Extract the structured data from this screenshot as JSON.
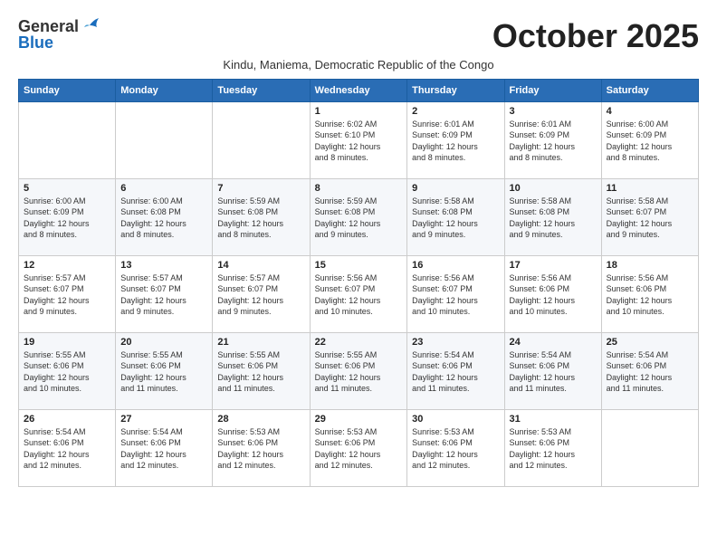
{
  "header": {
    "logo_general": "General",
    "logo_blue": "Blue",
    "month_title": "October 2025",
    "subtitle": "Kindu, Maniema, Democratic Republic of the Congo"
  },
  "weekdays": [
    "Sunday",
    "Monday",
    "Tuesday",
    "Wednesday",
    "Thursday",
    "Friday",
    "Saturday"
  ],
  "weeks": [
    [
      {
        "day": "",
        "info": ""
      },
      {
        "day": "",
        "info": ""
      },
      {
        "day": "",
        "info": ""
      },
      {
        "day": "1",
        "info": "Sunrise: 6:02 AM\nSunset: 6:10 PM\nDaylight: 12 hours\nand 8 minutes."
      },
      {
        "day": "2",
        "info": "Sunrise: 6:01 AM\nSunset: 6:09 PM\nDaylight: 12 hours\nand 8 minutes."
      },
      {
        "day": "3",
        "info": "Sunrise: 6:01 AM\nSunset: 6:09 PM\nDaylight: 12 hours\nand 8 minutes."
      },
      {
        "day": "4",
        "info": "Sunrise: 6:00 AM\nSunset: 6:09 PM\nDaylight: 12 hours\nand 8 minutes."
      }
    ],
    [
      {
        "day": "5",
        "info": "Sunrise: 6:00 AM\nSunset: 6:09 PM\nDaylight: 12 hours\nand 8 minutes."
      },
      {
        "day": "6",
        "info": "Sunrise: 6:00 AM\nSunset: 6:08 PM\nDaylight: 12 hours\nand 8 minutes."
      },
      {
        "day": "7",
        "info": "Sunrise: 5:59 AM\nSunset: 6:08 PM\nDaylight: 12 hours\nand 8 minutes."
      },
      {
        "day": "8",
        "info": "Sunrise: 5:59 AM\nSunset: 6:08 PM\nDaylight: 12 hours\nand 9 minutes."
      },
      {
        "day": "9",
        "info": "Sunrise: 5:58 AM\nSunset: 6:08 PM\nDaylight: 12 hours\nand 9 minutes."
      },
      {
        "day": "10",
        "info": "Sunrise: 5:58 AM\nSunset: 6:08 PM\nDaylight: 12 hours\nand 9 minutes."
      },
      {
        "day": "11",
        "info": "Sunrise: 5:58 AM\nSunset: 6:07 PM\nDaylight: 12 hours\nand 9 minutes."
      }
    ],
    [
      {
        "day": "12",
        "info": "Sunrise: 5:57 AM\nSunset: 6:07 PM\nDaylight: 12 hours\nand 9 minutes."
      },
      {
        "day": "13",
        "info": "Sunrise: 5:57 AM\nSunset: 6:07 PM\nDaylight: 12 hours\nand 9 minutes."
      },
      {
        "day": "14",
        "info": "Sunrise: 5:57 AM\nSunset: 6:07 PM\nDaylight: 12 hours\nand 9 minutes."
      },
      {
        "day": "15",
        "info": "Sunrise: 5:56 AM\nSunset: 6:07 PM\nDaylight: 12 hours\nand 10 minutes."
      },
      {
        "day": "16",
        "info": "Sunrise: 5:56 AM\nSunset: 6:07 PM\nDaylight: 12 hours\nand 10 minutes."
      },
      {
        "day": "17",
        "info": "Sunrise: 5:56 AM\nSunset: 6:06 PM\nDaylight: 12 hours\nand 10 minutes."
      },
      {
        "day": "18",
        "info": "Sunrise: 5:56 AM\nSunset: 6:06 PM\nDaylight: 12 hours\nand 10 minutes."
      }
    ],
    [
      {
        "day": "19",
        "info": "Sunrise: 5:55 AM\nSunset: 6:06 PM\nDaylight: 12 hours\nand 10 minutes."
      },
      {
        "day": "20",
        "info": "Sunrise: 5:55 AM\nSunset: 6:06 PM\nDaylight: 12 hours\nand 11 minutes."
      },
      {
        "day": "21",
        "info": "Sunrise: 5:55 AM\nSunset: 6:06 PM\nDaylight: 12 hours\nand 11 minutes."
      },
      {
        "day": "22",
        "info": "Sunrise: 5:55 AM\nSunset: 6:06 PM\nDaylight: 12 hours\nand 11 minutes."
      },
      {
        "day": "23",
        "info": "Sunrise: 5:54 AM\nSunset: 6:06 PM\nDaylight: 12 hours\nand 11 minutes."
      },
      {
        "day": "24",
        "info": "Sunrise: 5:54 AM\nSunset: 6:06 PM\nDaylight: 12 hours\nand 11 minutes."
      },
      {
        "day": "25",
        "info": "Sunrise: 5:54 AM\nSunset: 6:06 PM\nDaylight: 12 hours\nand 11 minutes."
      }
    ],
    [
      {
        "day": "26",
        "info": "Sunrise: 5:54 AM\nSunset: 6:06 PM\nDaylight: 12 hours\nand 12 minutes."
      },
      {
        "day": "27",
        "info": "Sunrise: 5:54 AM\nSunset: 6:06 PM\nDaylight: 12 hours\nand 12 minutes."
      },
      {
        "day": "28",
        "info": "Sunrise: 5:53 AM\nSunset: 6:06 PM\nDaylight: 12 hours\nand 12 minutes."
      },
      {
        "day": "29",
        "info": "Sunrise: 5:53 AM\nSunset: 6:06 PM\nDaylight: 12 hours\nand 12 minutes."
      },
      {
        "day": "30",
        "info": "Sunrise: 5:53 AM\nSunset: 6:06 PM\nDaylight: 12 hours\nand 12 minutes."
      },
      {
        "day": "31",
        "info": "Sunrise: 5:53 AM\nSunset: 6:06 PM\nDaylight: 12 hours\nand 12 minutes."
      },
      {
        "day": "",
        "info": ""
      }
    ]
  ]
}
